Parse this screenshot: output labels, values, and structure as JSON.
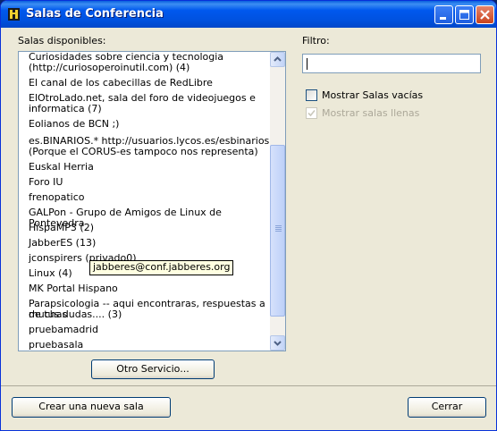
{
  "window": {
    "title": "Salas de Conferencia"
  },
  "rooms": {
    "label": "Salas disponibles:",
    "items": [
      "Curiosidades sobre ciencia y tecnologia",
      "(http://curiosoperoinutil.com) (4)",
      "El canal de los cabecillas de RedLibre",
      "ElOtroLado.net, sala del foro de videojuegos e",
      "informatica (7)",
      "Eolianos de BCN ;)",
      "es.BINARIOS.*  http://usuarios.lycos.es/esbinarios",
      "(Porque el CORUS-es tampoco nos representa)",
      "Euskal Herria",
      "Foro IU",
      "frenopatico",
      "GALPon - Grupo de Amigos de Linux de Pontevedra",
      "HispaMP3 (2)",
      "JabberES (13)",
      "jconspirers (privado0)",
      "Linux (4)",
      "MK Portal Hispano",
      "Parapsicologia -- aqui encontraras, respuestas a muchas",
      "de tus dudas.... (3)",
      "pruebamadrid",
      "pruebasala"
    ],
    "tooltip": "jabberes@conf.jabberes.org"
  },
  "buttons": {
    "other_service": "Otro Servicio...",
    "create_room": "Crear una nueva sala",
    "close": "Cerrar"
  },
  "filter": {
    "label": "Filtro:",
    "value": ""
  },
  "options": {
    "show_empty": {
      "label": "Mostrar Salas vacías",
      "checked": false
    },
    "show_full": {
      "label": "Mostrar salas llenas",
      "checked": true,
      "disabled": true
    }
  }
}
